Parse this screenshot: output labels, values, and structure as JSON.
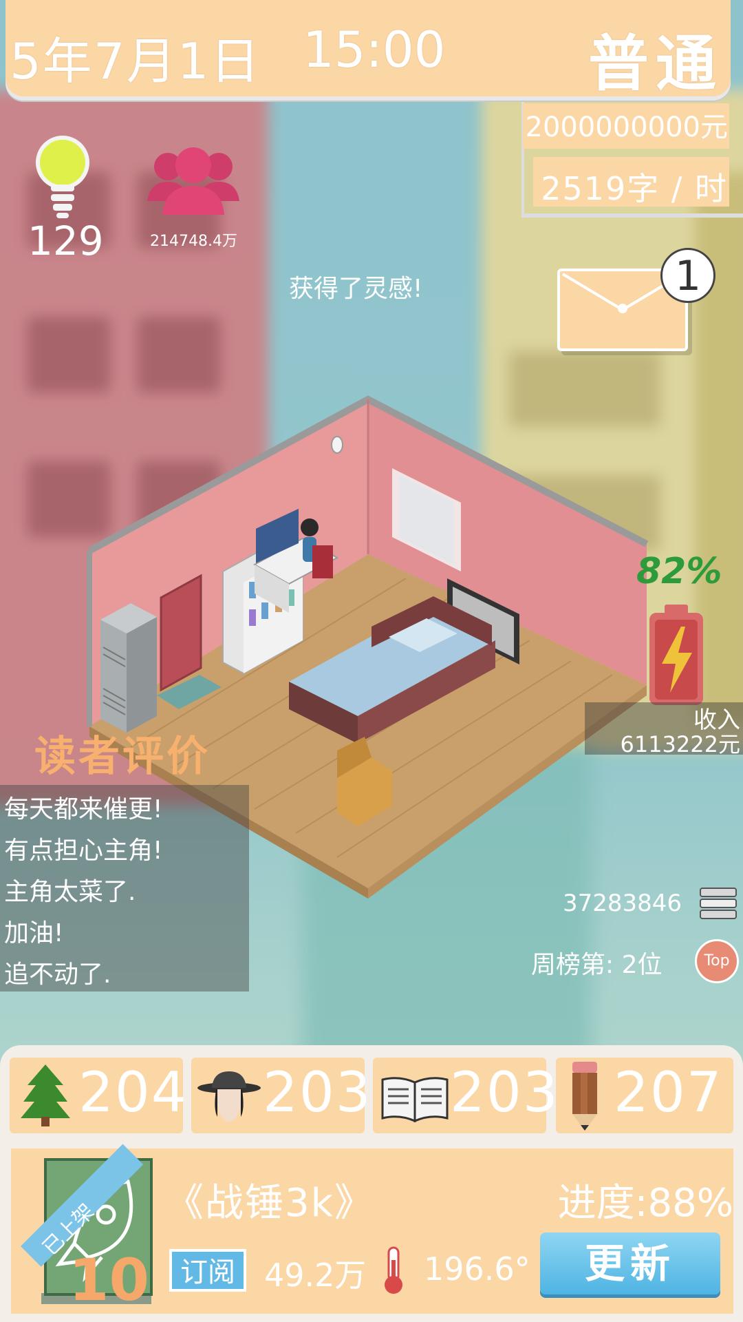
{
  "header": {
    "date": "5年7月1日",
    "time": "15:00",
    "difficulty": "普通"
  },
  "resources": {
    "money": "2000000000元",
    "writing_speed": "2519字 / 时"
  },
  "stats": {
    "inspiration": "129",
    "fans": "214748.4万",
    "inspiration_message": "获得了灵感!"
  },
  "mail": {
    "unread_count": "1"
  },
  "battery": {
    "percent_label": "82%",
    "level": 0.82
  },
  "income": {
    "label": "收入",
    "value": "6113222元"
  },
  "reviews": {
    "title": "读者评价",
    "items": [
      "每天都来催更!",
      "有点担心主角!",
      "主角太菜了.",
      "加油!",
      "追不动了."
    ]
  },
  "ranking": {
    "readers": "37283846",
    "weekly_rank": "周榜第: 2位",
    "top_label": "Top"
  },
  "attributes": [
    {
      "icon": "tree-icon",
      "value": "204"
    },
    {
      "icon": "character-icon",
      "value": "203"
    },
    {
      "icon": "book-icon",
      "value": "203"
    },
    {
      "icon": "pencil-icon",
      "value": "207"
    }
  ],
  "book": {
    "status_ribbon": "已上架",
    "volume": "10",
    "title": "《战锤3k》",
    "progress": "进度:88%",
    "subscribe_label": "订阅",
    "subscribers": "49.2万",
    "heat": "196.6°",
    "update_button": "更新"
  },
  "colors": {
    "panel": "#fcd7a6",
    "review_title": "#f7b06d",
    "battery_text": "#2e9b3a",
    "update_button": "#4fb4e3"
  }
}
